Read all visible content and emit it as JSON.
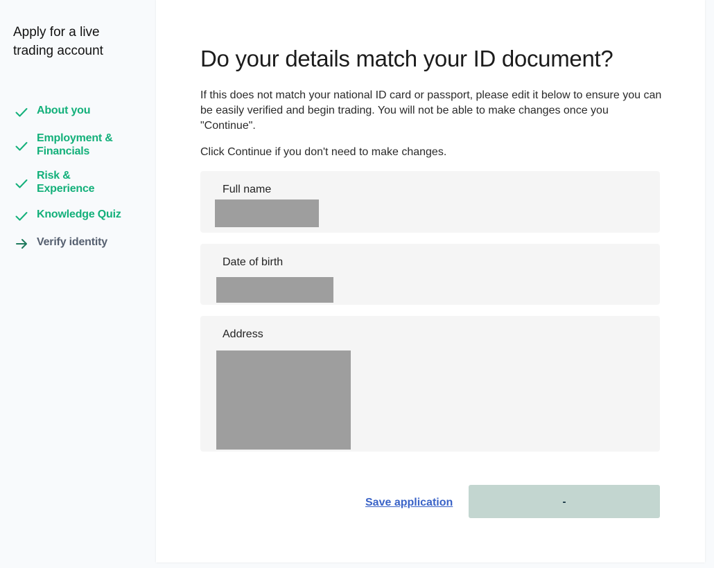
{
  "sidebar": {
    "title": "Apply for a live trading account",
    "steps": [
      {
        "label": "About you",
        "status": "complete",
        "icon": "check-icon"
      },
      {
        "label": "Employment & Financials",
        "status": "complete",
        "icon": "check-icon"
      },
      {
        "label": "Risk & Experience",
        "status": "complete",
        "icon": "check-icon"
      },
      {
        "label": "Knowledge Quiz",
        "status": "complete",
        "icon": "check-icon"
      },
      {
        "label": "Verify identity",
        "status": "current",
        "icon": "arrow-right-icon"
      }
    ]
  },
  "main": {
    "heading": "Do your details match your ID document?",
    "intro": "If this does not match your national ID card or passport, please edit it below to ensure you can be easily verified and begin trading. You will not be able to make changes once you \"Continue\".",
    "intro2": "Click Continue if you don't need to make changes.",
    "fields": [
      {
        "label": "Full name"
      },
      {
        "label": "Date of birth"
      },
      {
        "label": "Address"
      }
    ],
    "save_label": "Save application",
    "continue_label": "-"
  },
  "colors": {
    "accent_green": "#13b07a",
    "current_step": "#566070",
    "link_blue": "#3a63c7",
    "button_bg": "#c3d6d0",
    "card_bg": "#f5f5f5",
    "redacted": "#9e9e9e"
  }
}
